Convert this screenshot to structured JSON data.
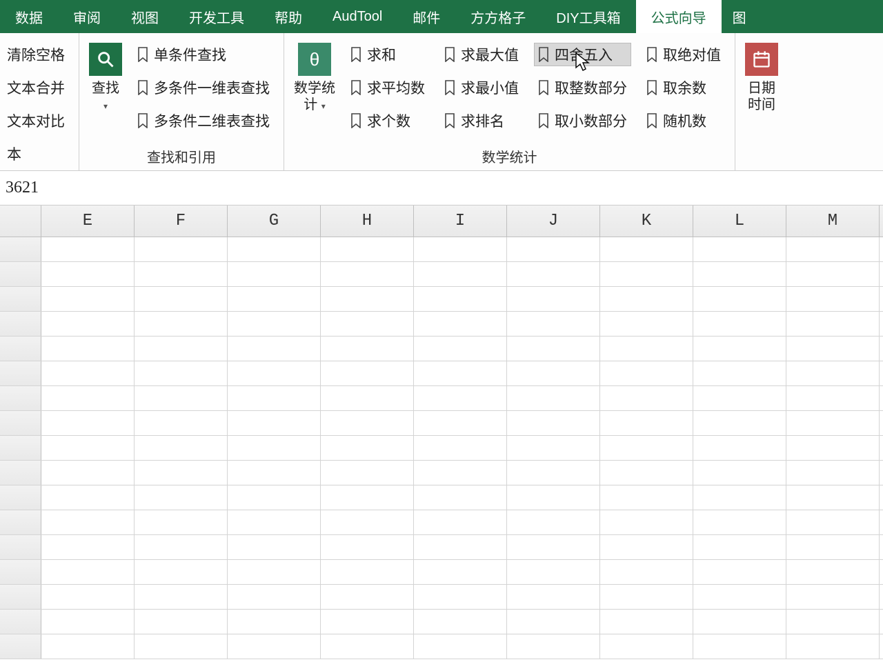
{
  "tabs": {
    "items": [
      "数据",
      "审阅",
      "视图",
      "开发工具",
      "帮助",
      "AudTool",
      "邮件",
      "方方格子",
      "DIY工具箱",
      "公式向导",
      "图"
    ],
    "active_index": 9
  },
  "ribbon": {
    "group_text": {
      "items": [
        "清除空格",
        "文本合并",
        "文本对比",
        "本"
      ],
      "label": ""
    },
    "group_lookup": {
      "bigbtn": {
        "label": "查找",
        "caret": "▾"
      },
      "items": [
        "单条件查找",
        "多条件一维表查找",
        "多条件二维表查找"
      ],
      "label": "查找和引用"
    },
    "group_math": {
      "bigbtn": {
        "label_line1": "数学统",
        "label_line2": "计",
        "caret": "▾",
        "glyph": "θ"
      },
      "col1": [
        "求和",
        "求平均数",
        "求个数"
      ],
      "col2": [
        "求最大值",
        "求最小值",
        "求排名"
      ],
      "col3": [
        "四舍五入",
        "取整数部分",
        "取小数部分"
      ],
      "col4": [
        "取绝对值",
        "取余数",
        "随机数"
      ],
      "label": "数学统计",
      "hover_item": "四舍五入"
    },
    "group_date": {
      "label_line1": "日期",
      "label_line2": "时间"
    }
  },
  "formula_bar": {
    "value": "3621"
  },
  "sheet": {
    "columns": [
      "E",
      "F",
      "G",
      "H",
      "I",
      "J",
      "K",
      "L",
      "M"
    ],
    "visible_rows": 17
  }
}
